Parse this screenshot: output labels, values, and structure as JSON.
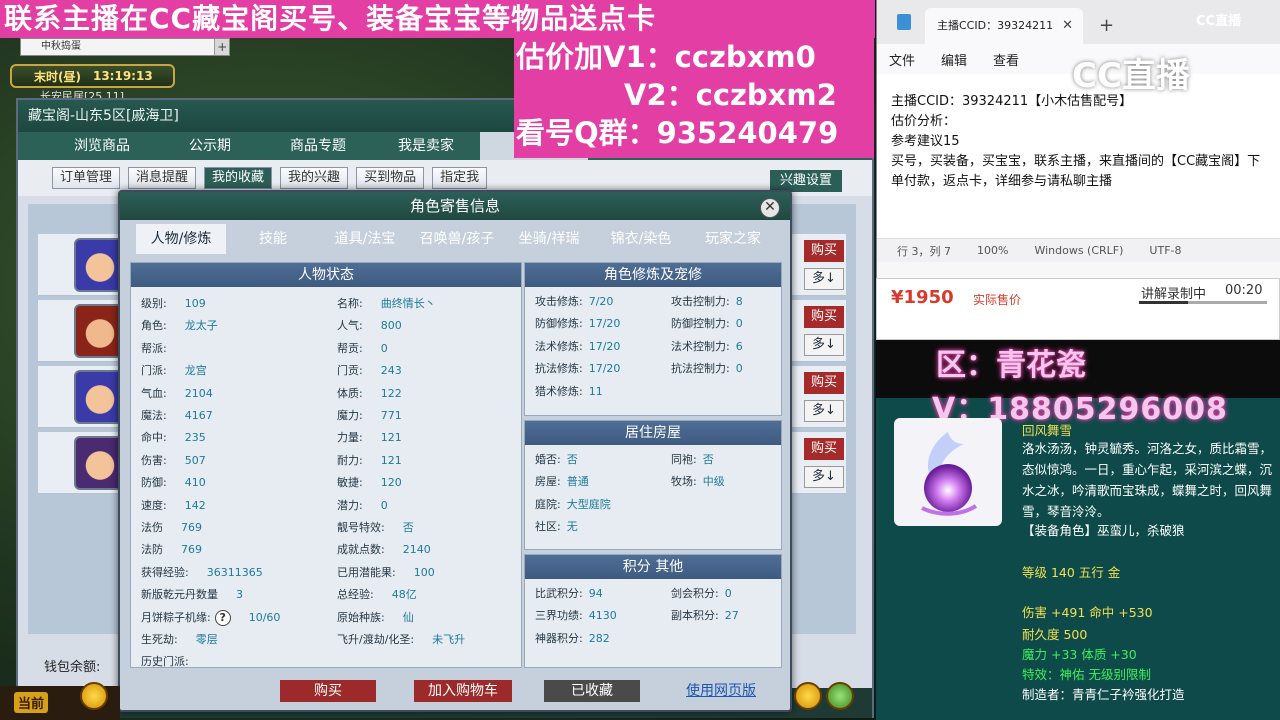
{
  "overlay": {
    "top_banner": "联系主播在CC藏宝阁买号、装备宝宝等物品送点卡",
    "line_v1": "估价加V1：cczbxm0",
    "line_v2": "V2：cczbxm2",
    "line_qq": "看号Q群：935240479"
  },
  "game": {
    "tab_title": "中秋捣蛋",
    "tab_plus": "+",
    "clock_period": "末时(昼)",
    "clock_time": "13:19:13",
    "map_label": "长安民居[25,11]"
  },
  "treasure": {
    "title": "藏宝阁-山东5区[戚海卫]",
    "nav": [
      "浏览商品",
      "公示期",
      "商品专题",
      "我是卖家",
      "我"
    ],
    "sub": [
      "订单管理",
      "消息提醒",
      "我的收藏",
      "我的兴趣",
      "买到物品",
      "指定我"
    ],
    "interest_btn": "兴趣设置",
    "row_buy": "购买",
    "row_more": "多↓",
    "wallet_label": "钱包余额:"
  },
  "dialog": {
    "title": "角色寄售信息",
    "close": "✕",
    "tabs": [
      "人物/修炼",
      "技能",
      "道具/法宝",
      "召唤兽/孩子",
      "坐骑/祥瑞",
      "锦衣/染色",
      "玩家之家"
    ],
    "panel_status": "人物状态",
    "panel_cultivation": "角色修炼及宠修",
    "panel_house": "居住房屋",
    "panel_score": "积分 其他",
    "status_left": [
      {
        "k": "级别:",
        "v": "109"
      },
      {
        "k": "角色:",
        "v": "龙太子"
      },
      {
        "k": "帮派:",
        "v": ""
      },
      {
        "k": "门派:",
        "v": "龙宫"
      },
      {
        "k": "气血:",
        "v": "2104"
      },
      {
        "k": "魔法:",
        "v": "4167"
      },
      {
        "k": "命中:",
        "v": "235"
      },
      {
        "k": "伤害:",
        "v": "507"
      },
      {
        "k": "防御:",
        "v": "410"
      },
      {
        "k": "速度:",
        "v": "142"
      },
      {
        "k": "法伤",
        "v": "769"
      },
      {
        "k": "法防",
        "v": "769"
      },
      {
        "k": "获得经验:",
        "v": "36311365"
      },
      {
        "k": "新版乾元丹数量",
        "v": "3"
      },
      {
        "k": "月饼粽子机缘:",
        "v": "10/60"
      },
      {
        "k": "生死劫:",
        "v": "零层"
      },
      {
        "k": "历史门派:",
        "v": ""
      }
    ],
    "status_right": [
      {
        "k": "名称:",
        "v": "曲终情长丶"
      },
      {
        "k": "人气:",
        "v": "800"
      },
      {
        "k": "帮贡:",
        "v": "0"
      },
      {
        "k": "门贡:",
        "v": "243"
      },
      {
        "k": "体质:",
        "v": "122"
      },
      {
        "k": "魔力:",
        "v": "771"
      },
      {
        "k": "力量:",
        "v": "121"
      },
      {
        "k": "耐力:",
        "v": "121"
      },
      {
        "k": "敏捷:",
        "v": "120"
      },
      {
        "k": "潜力:",
        "v": "0"
      },
      {
        "k": "靓号特效:",
        "v": "否"
      },
      {
        "k": "成就点数:",
        "v": "2140"
      },
      {
        "k": "已用潜能果:",
        "v": "100"
      },
      {
        "k": "总经验:",
        "v": "48亿"
      },
      {
        "k": "原始种族:",
        "v": "仙"
      },
      {
        "k": "飞升/渡劫/化圣:",
        "v": "未飞升"
      }
    ],
    "cult_left": [
      {
        "k": "攻击修炼:",
        "v": "7/20"
      },
      {
        "k": "防御修炼:",
        "v": "17/20"
      },
      {
        "k": "法术修炼:",
        "v": "17/20"
      },
      {
        "k": "抗法修炼:",
        "v": "17/20"
      },
      {
        "k": "猎术修炼:",
        "v": "11"
      }
    ],
    "cult_right": [
      {
        "k": "攻击控制力:",
        "v": "8"
      },
      {
        "k": "防御控制力:",
        "v": "0"
      },
      {
        "k": "法术控制力:",
        "v": "6"
      },
      {
        "k": "抗法控制力:",
        "v": "0"
      }
    ],
    "house_left": [
      {
        "k": "婚否:",
        "v": "否"
      },
      {
        "k": "房屋:",
        "v": "普通"
      },
      {
        "k": "庭院:",
        "v": "大型庭院"
      },
      {
        "k": "社区:",
        "v": "无"
      }
    ],
    "house_right": [
      {
        "k": "同袍:",
        "v": "否"
      },
      {
        "k": "牧场:",
        "v": "中级"
      }
    ],
    "score_left": [
      {
        "k": "比武积分:",
        "v": "94"
      },
      {
        "k": "三界功绩:",
        "v": "4130"
      },
      {
        "k": "神器积分:",
        "v": "282"
      }
    ],
    "score_right": [
      {
        "k": "剑会积分:",
        "v": "0"
      },
      {
        "k": "副本积分:",
        "v": "27"
      }
    ],
    "help_icon": "?",
    "btn_buy": "购买",
    "btn_cart": "加入购物车",
    "btn_fav": "已收藏",
    "btn_web": "使用网页版"
  },
  "notepad": {
    "tab_title": "主播CCID：39324211",
    "tab_close": "✕",
    "plus": "+",
    "menu": [
      "文件",
      "编辑",
      "查看"
    ],
    "lines": [
      "主播CCID：39324211【小木估售配号】",
      "估价分析：",
      "参考建议15",
      "买号，买装备，买宝宝，联系主播，来直播间的【CC藏宝阁】下单付款，返点卡，详细参与请私聊主播"
    ],
    "status": [
      "行 3，列 7",
      "100%",
      "Windows (CRLF)",
      "UTF-8"
    ]
  },
  "brand": {
    "small": "CC直播",
    "big": "CC直播"
  },
  "price": {
    "amount": "¥1950",
    "label": "实际售价",
    "rec_label": "讲解录制中",
    "rec_time": "00:20",
    "rec_progress": 0.38
  },
  "item": {
    "zone": "区：青花瓷",
    "contact": "V：18805296008",
    "name": "回风舞雪",
    "desc": "洛水汤汤，钟灵毓秀。河洛之女，质比霜雪，态似惊鸿。一日，重心乍起，采河滨之蝶，沉水之冰，吟清歌而宝珠成，蝶舞之时，回风舞雪，琴音泠泠。",
    "role": "【装备角色】巫蛮儿，杀破狼",
    "level": "等级 140 五行 金",
    "atk": "伤害 +491 命中 +530",
    "dur": "耐久度 500",
    "mag": "魔力 +33 体质 +30",
    "eff": "特效：神佑 无级别限制",
    "maker": "制造者：青青仁子衿强化打造"
  },
  "bottom": {
    "now": "当前"
  },
  "colors": {
    "banner": "#e23ea3",
    "teal": "#2c6158",
    "price_red": "#d63a2a",
    "item_yellow": "#f0e050",
    "item_green": "#3df05a"
  }
}
